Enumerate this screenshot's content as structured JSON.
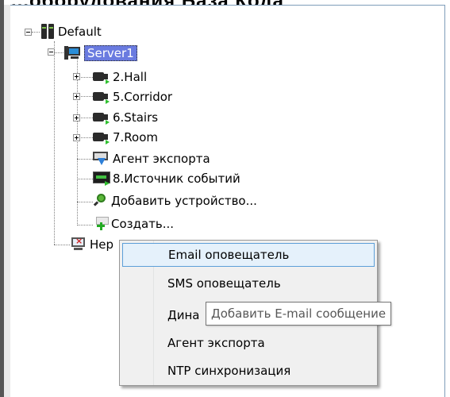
{
  "window": {
    "title_partial": "...оборудования База Кода"
  },
  "tree": {
    "root": {
      "label": "Default",
      "icon": "server-rack-icon",
      "expanded": true
    },
    "server": {
      "label": "Server1",
      "icon": "computer-icon",
      "expanded": true,
      "selected": true
    },
    "children": [
      {
        "label": "2.Hall",
        "icon": "camera-icon",
        "expandable": true
      },
      {
        "label": "5.Corridor",
        "icon": "camera-icon",
        "expandable": true
      },
      {
        "label": "6.Stairs",
        "icon": "camera-icon",
        "expandable": true
      },
      {
        "label": "7.Room",
        "icon": "camera-icon",
        "expandable": true
      },
      {
        "label": "Агент экспорта",
        "icon": "export-agent-icon",
        "expandable": false
      },
      {
        "label": "8.Источник событий",
        "icon": "event-source-icon",
        "expandable": false
      },
      {
        "label": "Добавить устройство...",
        "icon": "add-device-icon",
        "expandable": false
      },
      {
        "label": "Создать...",
        "icon": "create-icon",
        "expandable": false
      }
    ],
    "partial_node": {
      "label": "Нер",
      "icon": "hardware-icon"
    }
  },
  "context_menu": {
    "items": [
      {
        "label": "Email оповещатель",
        "highlighted": true
      },
      {
        "label": "SMS оповещатель",
        "highlighted": false
      },
      {
        "label": "Дина",
        "highlighted": false
      },
      {
        "label": "Агент экспорта",
        "highlighted": false
      },
      {
        "label": "NTP синхронизация",
        "highlighted": false
      }
    ]
  },
  "tooltip": {
    "text": "Добавить E-mail сообщение"
  },
  "colors": {
    "selection": "#6a7be0",
    "menu_highlight_bg": "#e5f1fb",
    "menu_highlight_border": "#5c9fd8"
  }
}
